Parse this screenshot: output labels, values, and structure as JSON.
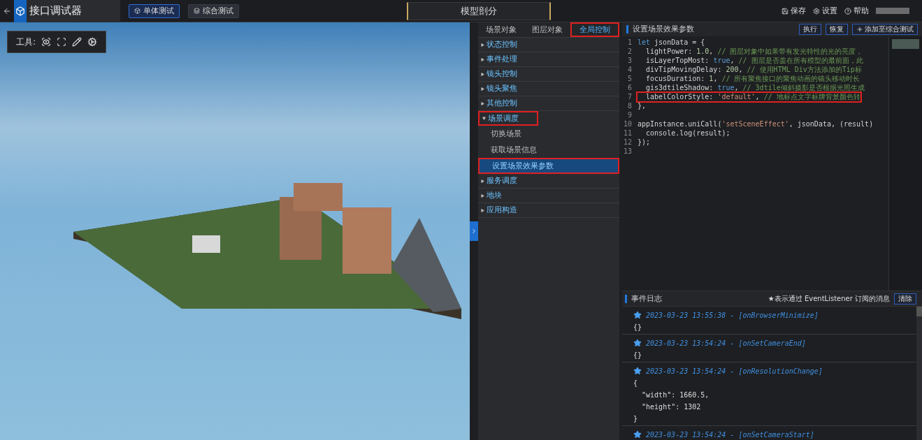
{
  "topbar": {
    "title": "接口调试器",
    "modes": [
      {
        "label": "单体测试",
        "selected": true
      },
      {
        "label": "综合测试",
        "selected": false
      }
    ],
    "center_title": "模型剖分",
    "actions": [
      {
        "kind": "save",
        "label": "保存"
      },
      {
        "kind": "settings",
        "label": "设置"
      },
      {
        "kind": "help",
        "label": "帮助"
      }
    ]
  },
  "viewport": {
    "tools_label": "工具:"
  },
  "tree_panel": {
    "tabs": [
      {
        "label": "场景对象",
        "selected": false,
        "annotated": false
      },
      {
        "label": "图层对象",
        "selected": false,
        "annotated": false
      },
      {
        "label": "全局控制",
        "selected": true,
        "annotated": true
      }
    ],
    "items": [
      {
        "label": "状态控制",
        "expanded": false,
        "annotated": false
      },
      {
        "label": "事件处理",
        "expanded": false,
        "annotated": false
      },
      {
        "label": "镜头控制",
        "expanded": false,
        "annotated": false
      },
      {
        "label": "镜头聚焦",
        "expanded": false,
        "annotated": false
      },
      {
        "label": "其他控制",
        "expanded": false,
        "annotated": false
      },
      {
        "label": "场景调度",
        "expanded": true,
        "annotated": true,
        "children": [
          {
            "label": "切换场景",
            "selected": false,
            "annotated": false
          },
          {
            "label": "获取场景信息",
            "selected": false,
            "annotated": false
          },
          {
            "label": "设置场景效果参数",
            "selected": true,
            "annotated": true
          }
        ]
      },
      {
        "label": "服务调度",
        "expanded": false,
        "annotated": false
      },
      {
        "label": "地块",
        "expanded": false,
        "annotated": false
      },
      {
        "label": "应用构造",
        "expanded": false,
        "annotated": false
      }
    ]
  },
  "editor": {
    "title": "设置场景效果参数",
    "buttons": [
      {
        "kind": "plain",
        "label": "执行"
      },
      {
        "kind": "plain",
        "label": "恢复"
      },
      {
        "kind": "add",
        "label": "添加至综合测试"
      }
    ],
    "lines": [
      {
        "number": "1",
        "annotated": false,
        "tokens": [
          {
            "kind": "kw",
            "text": "let"
          },
          {
            "kind": "id",
            "text": " jsonData = {"
          }
        ]
      },
      {
        "number": "2",
        "annotated": false,
        "tokens": [
          {
            "kind": "id",
            "text": "  lightPower: "
          },
          {
            "kind": "num",
            "text": "1.0"
          },
          {
            "kind": "id",
            "text": ", "
          },
          {
            "kind": "cmt",
            "text": "// 图层对象中如果带有发光特性的光的亮度，"
          }
        ]
      },
      {
        "number": "3",
        "annotated": false,
        "tokens": [
          {
            "kind": "id",
            "text": "  isLayerTopMost: "
          },
          {
            "kind": "kw",
            "text": "true"
          },
          {
            "kind": "id",
            "text": ", "
          },
          {
            "kind": "cmt",
            "text": "// 图层是否盖在所有模型的最前面，此"
          }
        ]
      },
      {
        "number": "4",
        "annotated": false,
        "tokens": [
          {
            "kind": "id",
            "text": "  divTipMovingDelay: "
          },
          {
            "kind": "num",
            "text": "200"
          },
          {
            "kind": "id",
            "text": ", "
          },
          {
            "kind": "cmt",
            "text": "// 使用HTML Div方法添加的Tip标"
          }
        ]
      },
      {
        "number": "5",
        "annotated": false,
        "tokens": [
          {
            "kind": "id",
            "text": "  focusDuration: "
          },
          {
            "kind": "num",
            "text": "1"
          },
          {
            "kind": "id",
            "text": ", "
          },
          {
            "kind": "cmt",
            "text": "// 所有聚焦接口的聚焦动画的镜头移动时长"
          }
        ]
      },
      {
        "number": "6",
        "annotated": false,
        "tokens": [
          {
            "kind": "id",
            "text": "  gis3dtileShadow: "
          },
          {
            "kind": "kw",
            "text": "true"
          },
          {
            "kind": "id",
            "text": ", "
          },
          {
            "kind": "cmt",
            "text": "// 3dtile倾斜摄影是否根据光照生成"
          }
        ]
      },
      {
        "number": "7",
        "annotated": true,
        "tokens": [
          {
            "kind": "id",
            "text": "  labelColorStyle: "
          },
          {
            "kind": "str",
            "text": "'default'"
          },
          {
            "kind": "id",
            "text": ", "
          },
          {
            "kind": "cmt",
            "text": "// 地标点文字标牌背景颜色转"
          }
        ]
      },
      {
        "number": "8",
        "annotated": false,
        "tokens": [
          {
            "kind": "id",
            "text": "},"
          }
        ]
      },
      {
        "number": "9"
      },
      {
        "number": "10",
        "annotated": false,
        "tokens": [
          {
            "kind": "id",
            "text": "appInstance.uniCall("
          },
          {
            "kind": "str",
            "text": "'setSceneEffect'"
          },
          {
            "kind": "id",
            "text": ", jsonData, (result)"
          }
        ]
      },
      {
        "number": "11",
        "annotated": false,
        "tokens": [
          {
            "kind": "id",
            "text": "  console.log(result);"
          }
        ]
      },
      {
        "number": "12",
        "annotated": false,
        "tokens": [
          {
            "kind": "id",
            "text": "});"
          }
        ]
      },
      {
        "number": "13"
      }
    ]
  },
  "event_log": {
    "title": "事件日志",
    "hint": "★表示通过 EventListener 订阅的消息",
    "clear_button": "清除",
    "entries": [
      {
        "heading": "2023-03-23 13:55:38 - [onBrowserMinimize]",
        "body": [
          "{}"
        ]
      },
      {
        "heading": "2023-03-23 13:54:24 - [onSetCameraEnd]",
        "body": [
          "{}"
        ]
      },
      {
        "heading": "2023-03-23 13:54:24 - [onResolutionChange]",
        "body": [
          "{",
          "  \"width\": 1660.5,",
          "  \"height\": 1302",
          "}"
        ]
      },
      {
        "heading": "2023-03-23 13:54:24 - [onSetCameraStart]"
      }
    ]
  }
}
